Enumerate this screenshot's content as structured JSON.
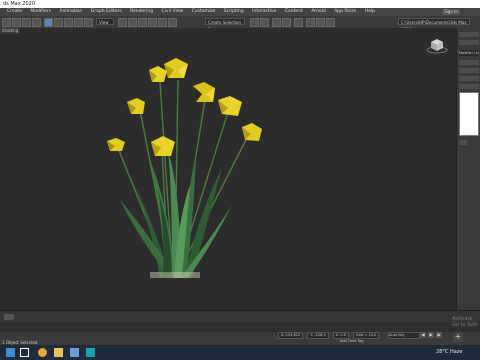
{
  "window": {
    "title": "ds Max 2020"
  },
  "menu": [
    "Create",
    "Modifiers",
    "Animation",
    "Graph Editors",
    "Rendering",
    "Civil View",
    "Customize",
    "Scripting",
    "Interactive",
    "Content",
    "Arnold",
    "App Store",
    "Help"
  ],
  "signin": "Sign In",
  "toolbar": {
    "view_dropdown": "View",
    "selection_set_dropdown": "Create Selection Se",
    "path_dropdown": "C:\\Users\\HP\\Documents\\3ds Max 2020\\"
  },
  "viewport": {
    "label": "Shading"
  },
  "command_panel": {
    "modifier_list": "Modifier List"
  },
  "statusbar": {
    "status": "1 Object Selected",
    "x": "X: 153.822",
    "y": "Y: -226.3",
    "z": "Z: 0.0",
    "grid": "Grid = 10.0",
    "add_time_tag": "Add Time Tag",
    "set_key": "Auto Key",
    "selected": "Selected"
  },
  "watermark": {
    "line1": "Activate",
    "line2": "Go to Sett"
  },
  "taskbar": {
    "weather": "28°C Haze"
  },
  "colors": {
    "petal": "#e2cc22",
    "leaf": "#3e7a45",
    "bg": "#2c2c2c"
  }
}
